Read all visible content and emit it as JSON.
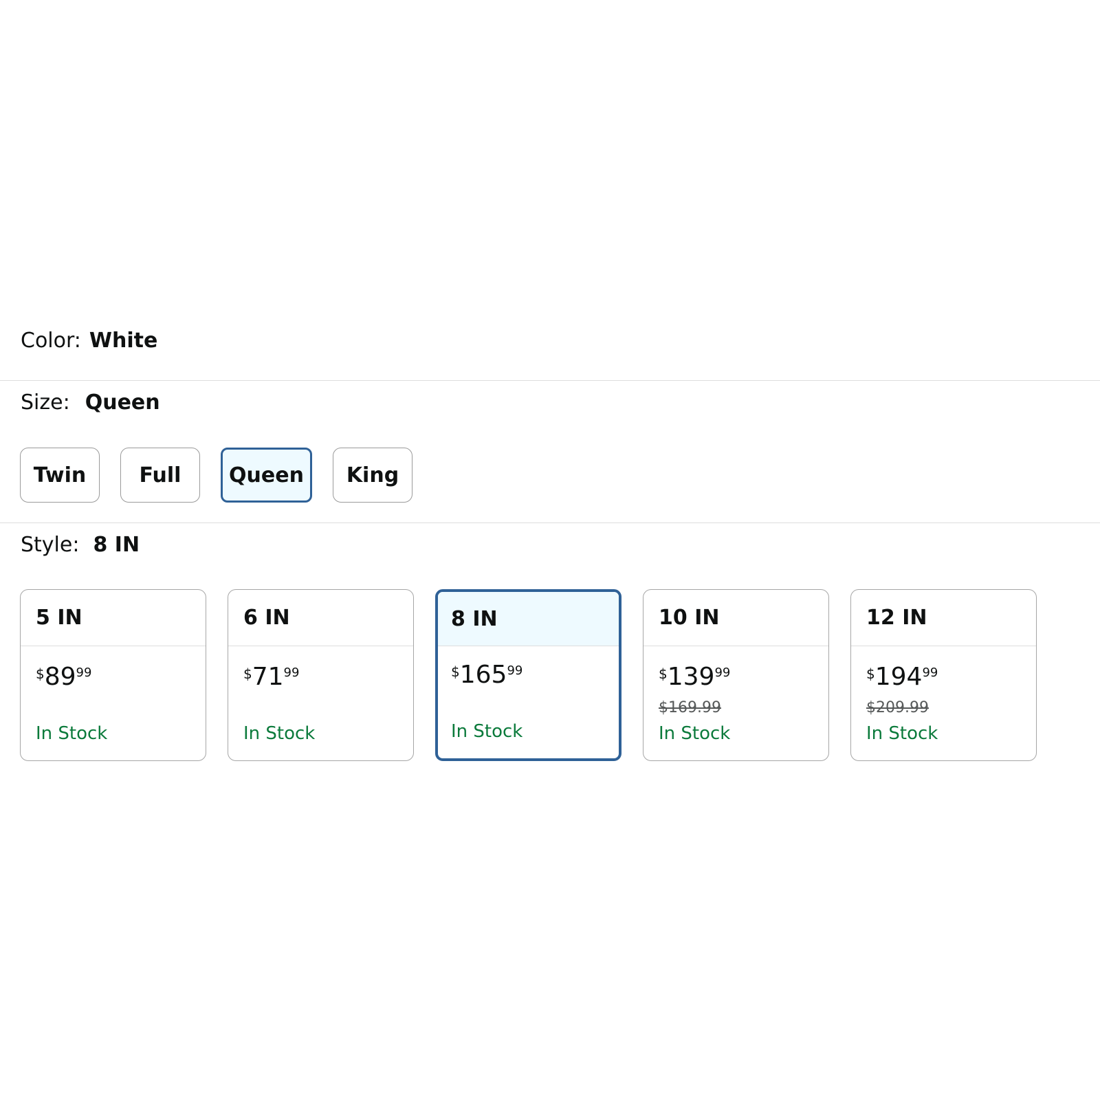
{
  "color": {
    "label": "Color:",
    "value": "White"
  },
  "size": {
    "label": "Size:",
    "value": "Queen",
    "options": [
      {
        "label": "Twin",
        "selected": false
      },
      {
        "label": "Full",
        "selected": false
      },
      {
        "label": "Queen",
        "selected": true
      },
      {
        "label": "King",
        "selected": false
      }
    ]
  },
  "style": {
    "label": "Style:",
    "value": "8 IN",
    "options": [
      {
        "label": "5 IN",
        "currency": "$",
        "whole": "89",
        "fraction": "99",
        "was": "",
        "stock": "In Stock",
        "selected": false
      },
      {
        "label": "6 IN",
        "currency": "$",
        "whole": "71",
        "fraction": "99",
        "was": "",
        "stock": "In Stock",
        "selected": false
      },
      {
        "label": "8 IN",
        "currency": "$",
        "whole": "165",
        "fraction": "99",
        "was": "",
        "stock": "In Stock",
        "selected": true
      },
      {
        "label": "10 IN",
        "currency": "$",
        "whole": "139",
        "fraction": "99",
        "was": "$169.99",
        "stock": "In Stock",
        "selected": false
      },
      {
        "label": "12 IN",
        "currency": "$",
        "whole": "194",
        "fraction": "99",
        "was": "$209.99",
        "stock": "In Stock",
        "selected": false
      }
    ]
  },
  "colors": {
    "selected_border": "#2f6197",
    "selected_fill": "#eefaff",
    "in_stock": "#0b7a3b",
    "strike_price": "#565959"
  }
}
